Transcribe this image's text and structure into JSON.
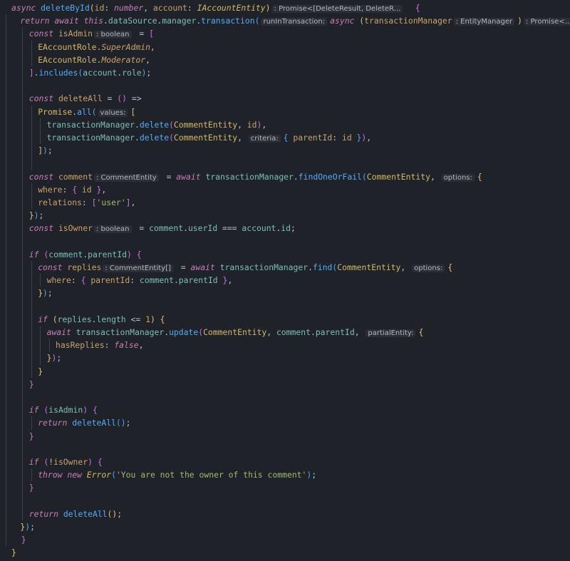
{
  "colors": {
    "background": "#1f2229",
    "guide": "#3c4049",
    "hint_bg": "#2b2e36",
    "hint_fg": "#b3b8c2",
    "keyword": "#c77dbb",
    "function": "#57aaf7",
    "param": "#c9a26d",
    "type": "#d4b86a",
    "property": "#7ebfb8",
    "string": "#9fba70",
    "punct": "#b9c0cc",
    "bracket_yellow": "#e5c07b",
    "bracket_pink": "#ce6ee5",
    "bracket_blue": "#4ea5f5"
  },
  "lines": [
    {
      "indent": 0,
      "tokens": [
        {
          "t": "async ",
          "c": "kw",
          "i": 1
        },
        {
          "t": "deleteById",
          "c": "fn"
        },
        {
          "t": "(",
          "c": "by"
        },
        {
          "t": "id",
          "c": "pm"
        },
        {
          "t": ": ",
          "c": "p"
        },
        {
          "t": "number",
          "c": "kw",
          "i": 1
        },
        {
          "t": ", ",
          "c": "p"
        },
        {
          "t": "account",
          "c": "pm"
        },
        {
          "t": ": ",
          "c": "p"
        },
        {
          "t": "IAccountEntity",
          "c": "ty",
          "i": 1
        },
        {
          "t": ")",
          "c": "by"
        },
        {
          "h": ": Promise<[DeleteResult, DeleteR..."
        },
        {
          "t": "  {",
          "c": "bp"
        }
      ]
    },
    {
      "indent": 1,
      "tokens": [
        {
          "t": "return ",
          "c": "kw",
          "i": 1
        },
        {
          "t": "await ",
          "c": "kw",
          "i": 1
        },
        {
          "t": "this",
          "c": "kw",
          "i": 1
        },
        {
          "t": ".",
          "c": "p"
        },
        {
          "t": "dataSource",
          "c": "pr"
        },
        {
          "t": ".",
          "c": "p"
        },
        {
          "t": "manager",
          "c": "pr"
        },
        {
          "t": ".",
          "c": "p"
        },
        {
          "t": "transaction",
          "c": "fn"
        },
        {
          "t": "(",
          "c": "bb"
        },
        {
          "h": "runInTransaction:"
        },
        {
          "t": "async ",
          "c": "kw",
          "i": 1
        },
        {
          "t": "(",
          "c": "by"
        },
        {
          "t": "transactionManager",
          "c": "pm"
        },
        {
          "h": ": EntityManager"
        },
        {
          "t": ")",
          "c": "by"
        },
        {
          "h": ": Promise<...>"
        },
        {
          "t": " => ",
          "c": "p"
        },
        {
          "t": "{",
          "c": "by"
        }
      ]
    },
    {
      "indent": 2,
      "tokens": [
        {
          "t": "const ",
          "c": "kw",
          "i": 1
        },
        {
          "t": "isAdmin",
          "c": "pm"
        },
        {
          "h": ": boolean"
        },
        {
          "t": " = ",
          "c": "p"
        },
        {
          "t": "[",
          "c": "bp"
        }
      ]
    },
    {
      "indent": 3,
      "tokens": [
        {
          "t": "EAccountRole",
          "c": "ty"
        },
        {
          "t": ".",
          "c": "p"
        },
        {
          "t": "SuperAdmin",
          "c": "pm",
          "i": 1
        },
        {
          "t": ",",
          "c": "p"
        }
      ]
    },
    {
      "indent": 3,
      "tokens": [
        {
          "t": "EAccountRole",
          "c": "ty"
        },
        {
          "t": ".",
          "c": "p"
        },
        {
          "t": "Moderator",
          "c": "pm",
          "i": 1
        },
        {
          "t": ",",
          "c": "p"
        }
      ]
    },
    {
      "indent": 2,
      "tokens": [
        {
          "t": "]",
          "c": "bp"
        },
        {
          "t": ".",
          "c": "p"
        },
        {
          "t": "includes",
          "c": "fn"
        },
        {
          "t": "(",
          "c": "bb"
        },
        {
          "t": "account",
          "c": "pr"
        },
        {
          "t": ".",
          "c": "p"
        },
        {
          "t": "role",
          "c": "pr"
        },
        {
          "t": ")",
          "c": "bb"
        },
        {
          "t": ";",
          "c": "p"
        }
      ]
    },
    {
      "indent": 0,
      "tokens": []
    },
    {
      "indent": 2,
      "tokens": [
        {
          "t": "const ",
          "c": "kw",
          "i": 1
        },
        {
          "t": "deleteAll",
          "c": "pm"
        },
        {
          "t": " = ",
          "c": "p"
        },
        {
          "t": "()",
          "c": "bp"
        },
        {
          "t": " => ",
          "c": "p"
        }
      ]
    },
    {
      "indent": 3,
      "tokens": [
        {
          "t": "Promise",
          "c": "ty"
        },
        {
          "t": ".",
          "c": "p"
        },
        {
          "t": "all",
          "c": "fn"
        },
        {
          "t": "(",
          "c": "bb"
        },
        {
          "h": "values:"
        },
        {
          "t": "[",
          "c": "by"
        }
      ]
    },
    {
      "indent": 4,
      "tokens": [
        {
          "t": "transactionManager",
          "c": "pr"
        },
        {
          "t": ".",
          "c": "p"
        },
        {
          "t": "delete",
          "c": "fn"
        },
        {
          "t": "(",
          "c": "bp"
        },
        {
          "t": "CommentEntity",
          "c": "ty"
        },
        {
          "t": ", ",
          "c": "p"
        },
        {
          "t": "id",
          "c": "pm"
        },
        {
          "t": ")",
          "c": "bp"
        },
        {
          "t": ",",
          "c": "p"
        }
      ]
    },
    {
      "indent": 4,
      "tokens": [
        {
          "t": "transactionManager",
          "c": "pr"
        },
        {
          "t": ".",
          "c": "p"
        },
        {
          "t": "delete",
          "c": "fn"
        },
        {
          "t": "(",
          "c": "bp"
        },
        {
          "t": "CommentEntity",
          "c": "ty"
        },
        {
          "t": ", ",
          "c": "p"
        },
        {
          "h": "criteria:"
        },
        {
          "t": "{ ",
          "c": "bb"
        },
        {
          "t": "parentId",
          "c": "pm"
        },
        {
          "t": ": ",
          "c": "p"
        },
        {
          "t": "id",
          "c": "pm"
        },
        {
          "t": " }",
          "c": "bb"
        },
        {
          "t": ")",
          "c": "bp"
        },
        {
          "t": ",",
          "c": "p"
        }
      ]
    },
    {
      "indent": 3,
      "tokens": [
        {
          "t": "]",
          "c": "by"
        },
        {
          "t": ")",
          "c": "bb"
        },
        {
          "t": ";",
          "c": "p"
        }
      ]
    },
    {
      "indent": 0,
      "tokens": []
    },
    {
      "indent": 2,
      "tokens": [
        {
          "t": "const ",
          "c": "kw",
          "i": 1
        },
        {
          "t": "comment",
          "c": "pm"
        },
        {
          "h": ": CommentEntity"
        },
        {
          "t": " = ",
          "c": "p"
        },
        {
          "t": "await ",
          "c": "kw",
          "i": 1
        },
        {
          "t": "transactionManager",
          "c": "pr"
        },
        {
          "t": ".",
          "c": "p"
        },
        {
          "t": "findOneOrFail",
          "c": "fn"
        },
        {
          "t": "(",
          "c": "bb"
        },
        {
          "t": "CommentEntity",
          "c": "ty"
        },
        {
          "t": ", ",
          "c": "p"
        },
        {
          "h": "options:"
        },
        {
          "t": "{",
          "c": "by"
        }
      ]
    },
    {
      "indent": 3,
      "tokens": [
        {
          "t": "where",
          "c": "pm"
        },
        {
          "t": ": ",
          "c": "p"
        },
        {
          "t": "{ ",
          "c": "bp"
        },
        {
          "t": "id",
          "c": "pm"
        },
        {
          "t": " }",
          "c": "bp"
        },
        {
          "t": ",",
          "c": "p"
        }
      ]
    },
    {
      "indent": 3,
      "tokens": [
        {
          "t": "relations",
          "c": "pm"
        },
        {
          "t": ": ",
          "c": "p"
        },
        {
          "t": "[",
          "c": "bp"
        },
        {
          "t": "'user'",
          "c": "st"
        },
        {
          "t": "]",
          "c": "bp"
        },
        {
          "t": ",",
          "c": "p"
        }
      ]
    },
    {
      "indent": 2,
      "tokens": [
        {
          "t": "}",
          "c": "by"
        },
        {
          "t": ")",
          "c": "bb"
        },
        {
          "t": ";",
          "c": "p"
        }
      ]
    },
    {
      "indent": 2,
      "tokens": [
        {
          "t": "const ",
          "c": "kw",
          "i": 1
        },
        {
          "t": "isOwner",
          "c": "pm"
        },
        {
          "h": ": boolean"
        },
        {
          "t": " = ",
          "c": "p"
        },
        {
          "t": "comment",
          "c": "pr"
        },
        {
          "t": ".",
          "c": "p"
        },
        {
          "t": "userId",
          "c": "pr"
        },
        {
          "t": " === ",
          "c": "p"
        },
        {
          "t": "account",
          "c": "pr"
        },
        {
          "t": ".",
          "c": "p"
        },
        {
          "t": "id",
          "c": "pr"
        },
        {
          "t": ";",
          "c": "p"
        }
      ]
    },
    {
      "indent": 0,
      "tokens": []
    },
    {
      "indent": 2,
      "tokens": [
        {
          "t": "if ",
          "c": "kw",
          "i": 1
        },
        {
          "t": "(",
          "c": "bp"
        },
        {
          "t": "comment",
          "c": "pr"
        },
        {
          "t": ".",
          "c": "p"
        },
        {
          "t": "parentId",
          "c": "pr"
        },
        {
          "t": ")",
          "c": "bp"
        },
        {
          "t": " {",
          "c": "bp"
        }
      ]
    },
    {
      "indent": 3,
      "tokens": [
        {
          "t": "const ",
          "c": "kw",
          "i": 1
        },
        {
          "t": "replies",
          "c": "pm"
        },
        {
          "h": ": CommentEntity[]"
        },
        {
          "t": " = ",
          "c": "p"
        },
        {
          "t": "await ",
          "c": "kw",
          "i": 1
        },
        {
          "t": "transactionManager",
          "c": "pr"
        },
        {
          "t": ".",
          "c": "p"
        },
        {
          "t": "find",
          "c": "fn"
        },
        {
          "t": "(",
          "c": "bb"
        },
        {
          "t": "CommentEntity",
          "c": "ty"
        },
        {
          "t": ", ",
          "c": "p"
        },
        {
          "h": "options:"
        },
        {
          "t": "{",
          "c": "by"
        }
      ]
    },
    {
      "indent": 4,
      "tokens": [
        {
          "t": "where",
          "c": "pm"
        },
        {
          "t": ": ",
          "c": "p"
        },
        {
          "t": "{ ",
          "c": "bp"
        },
        {
          "t": "parentId",
          "c": "pm"
        },
        {
          "t": ": ",
          "c": "p"
        },
        {
          "t": "comment",
          "c": "pr"
        },
        {
          "t": ".",
          "c": "p"
        },
        {
          "t": "parentId",
          "c": "pr"
        },
        {
          "t": " }",
          "c": "bp"
        },
        {
          "t": ",",
          "c": "p"
        }
      ]
    },
    {
      "indent": 3,
      "tokens": [
        {
          "t": "}",
          "c": "by"
        },
        {
          "t": ")",
          "c": "bb"
        },
        {
          "t": ";",
          "c": "p"
        }
      ]
    },
    {
      "indent": 0,
      "tokens": []
    },
    {
      "indent": 3,
      "tokens": [
        {
          "t": "if ",
          "c": "kw",
          "i": 1
        },
        {
          "t": "(",
          "c": "by"
        },
        {
          "t": "replies",
          "c": "pr"
        },
        {
          "t": ".",
          "c": "p"
        },
        {
          "t": "length",
          "c": "pr"
        },
        {
          "t": " <= ",
          "c": "p"
        },
        {
          "t": "1",
          "c": "pm"
        },
        {
          "t": ")",
          "c": "by"
        },
        {
          "t": " {",
          "c": "by"
        }
      ]
    },
    {
      "indent": 4,
      "tokens": [
        {
          "t": "await ",
          "c": "kw",
          "i": 1
        },
        {
          "t": "transactionManager",
          "c": "pr"
        },
        {
          "t": ".",
          "c": "p"
        },
        {
          "t": "update",
          "c": "fn"
        },
        {
          "t": "(",
          "c": "bp"
        },
        {
          "t": "CommentEntity",
          "c": "ty"
        },
        {
          "t": ", ",
          "c": "p"
        },
        {
          "t": "comment",
          "c": "pr"
        },
        {
          "t": ".",
          "c": "p"
        },
        {
          "t": "parentId",
          "c": "pr"
        },
        {
          "t": ", ",
          "c": "p"
        },
        {
          "h": "partialEntity:"
        },
        {
          "t": "{",
          "c": "by"
        }
      ]
    },
    {
      "indent": 5,
      "tokens": [
        {
          "t": "hasReplies",
          "c": "pm"
        },
        {
          "t": ": ",
          "c": "p"
        },
        {
          "t": "false",
          "c": "kw",
          "i": 1
        },
        {
          "t": ",",
          "c": "p"
        }
      ]
    },
    {
      "indent": 4,
      "tokens": [
        {
          "t": "}",
          "c": "by"
        },
        {
          "t": ")",
          "c": "bp"
        },
        {
          "t": ";",
          "c": "p"
        }
      ]
    },
    {
      "indent": 3,
      "tokens": [
        {
          "t": "}",
          "c": "by"
        }
      ]
    },
    {
      "indent": 2,
      "tokens": [
        {
          "t": "}",
          "c": "bp"
        }
      ]
    },
    {
      "indent": 0,
      "tokens": []
    },
    {
      "indent": 2,
      "tokens": [
        {
          "t": "if ",
          "c": "kw",
          "i": 1
        },
        {
          "t": "(",
          "c": "bp"
        },
        {
          "t": "isAdmin",
          "c": "pr"
        },
        {
          "t": ")",
          "c": "bp"
        },
        {
          "t": " {",
          "c": "bp"
        }
      ]
    },
    {
      "indent": 3,
      "tokens": [
        {
          "t": "return ",
          "c": "kw",
          "i": 1
        },
        {
          "t": "deleteAll",
          "c": "fn"
        },
        {
          "t": "()",
          "c": "bb"
        },
        {
          "t": ";",
          "c": "p"
        }
      ]
    },
    {
      "indent": 2,
      "tokens": [
        {
          "t": "}",
          "c": "bp"
        }
      ]
    },
    {
      "indent": 0,
      "tokens": []
    },
    {
      "indent": 2,
      "tokens": [
        {
          "t": "if ",
          "c": "kw",
          "i": 1
        },
        {
          "t": "(",
          "c": "bp"
        },
        {
          "t": "!",
          "c": "p"
        },
        {
          "t": "isOwner",
          "c": "pm"
        },
        {
          "t": ")",
          "c": "bp"
        },
        {
          "t": " {",
          "c": "bp"
        }
      ]
    },
    {
      "indent": 3,
      "tokens": [
        {
          "t": "throw ",
          "c": "kw",
          "i": 1
        },
        {
          "t": "new ",
          "c": "kw",
          "i": 1
        },
        {
          "t": "Error",
          "c": "ty",
          "i": 1
        },
        {
          "t": "(",
          "c": "bb"
        },
        {
          "t": "'You are not the owner of this comment'",
          "c": "st"
        },
        {
          "t": ")",
          "c": "bb"
        },
        {
          "t": ";",
          "c": "p"
        }
      ]
    },
    {
      "indent": 2,
      "tokens": [
        {
          "t": "}",
          "c": "bp"
        }
      ]
    },
    {
      "indent": 0,
      "tokens": []
    },
    {
      "indent": 2,
      "tokens": [
        {
          "t": "return ",
          "c": "kw",
          "i": 1
        },
        {
          "t": "deleteAll",
          "c": "fn"
        },
        {
          "t": "()",
          "c": "by"
        },
        {
          "t": ";",
          "c": "p"
        }
      ]
    },
    {
      "indent": 1,
      "tokens": [
        {
          "t": "}",
          "c": "by"
        },
        {
          "t": ")",
          "c": "bb"
        },
        {
          "t": ";",
          "c": "p"
        }
      ]
    },
    {
      "indent": 0,
      "tokens": [
        {
          "t": "  }",
          "c": "bp"
        }
      ]
    },
    {
      "indent": 0,
      "tokens": [
        {
          "t": "}",
          "c": "by"
        }
      ]
    }
  ]
}
